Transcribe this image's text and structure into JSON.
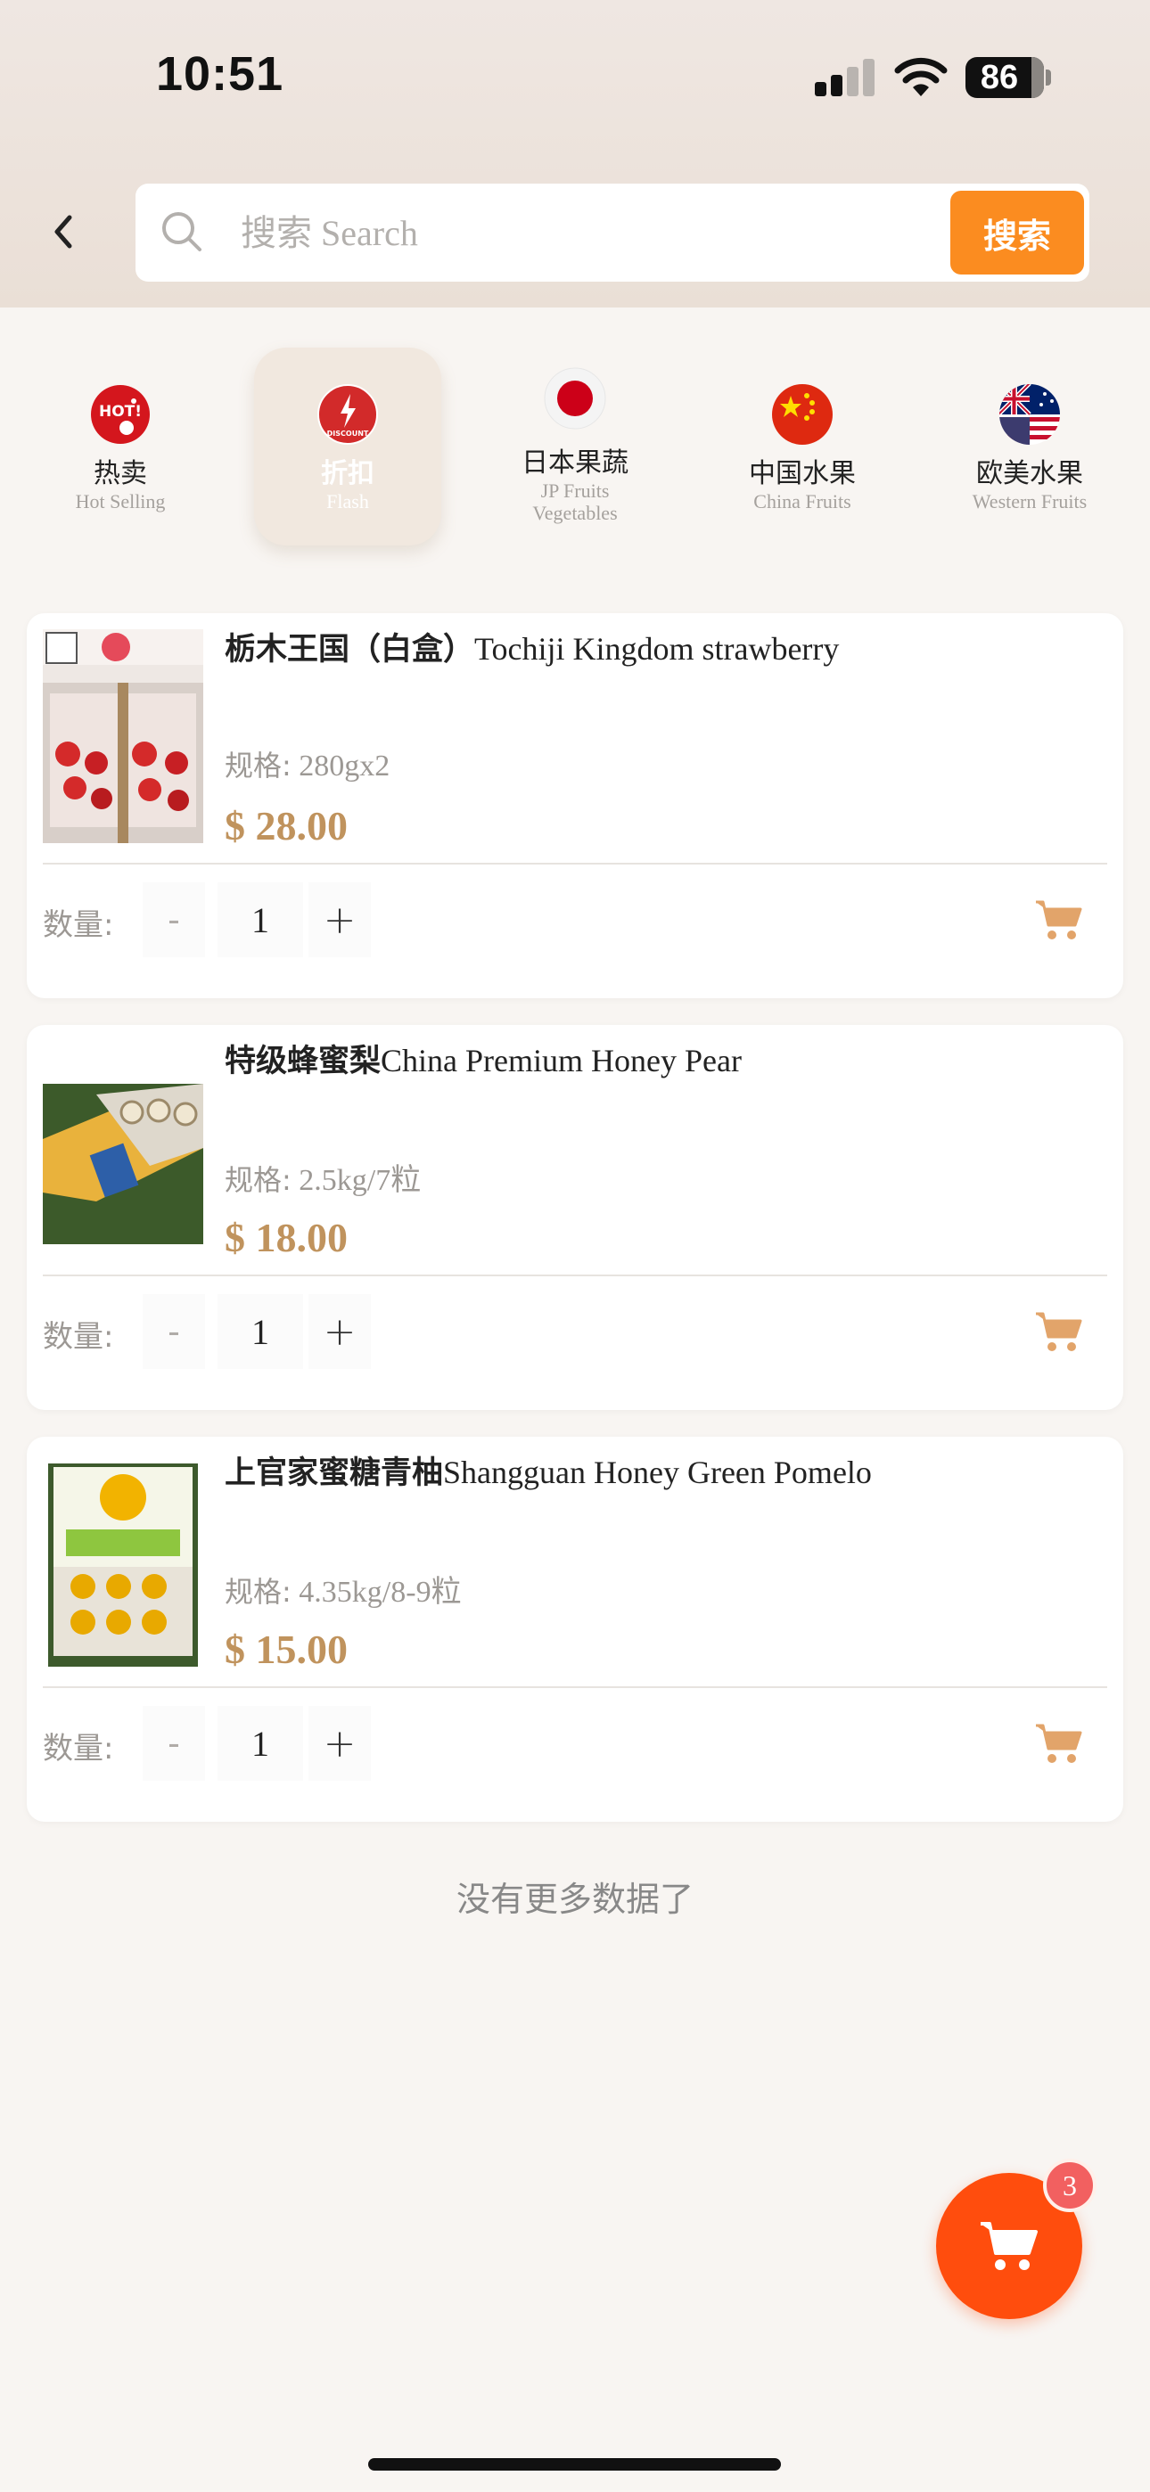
{
  "status_bar": {
    "time": "10:51",
    "battery": "86"
  },
  "search": {
    "placeholder": "搜索 Search",
    "button_label": "搜索"
  },
  "categories": [
    {
      "zh": "热卖",
      "en": "Hot Selling",
      "icon": "hot-badge-icon",
      "active": false
    },
    {
      "zh": "折扣",
      "en": "Flash",
      "icon": "discount-badge-icon",
      "active": true
    },
    {
      "zh": "日本果蔬",
      "en": "JP Fruits Vegetables",
      "icon": "japan-flag-icon",
      "active": false
    },
    {
      "zh": "中国水果",
      "en": "China Fruits",
      "icon": "china-flag-icon",
      "active": false
    },
    {
      "zh": "欧美水果",
      "en": "Western Fruits",
      "icon": "us-australia-flag-icon",
      "active": false
    }
  ],
  "spec_label": "规格:",
  "qty_label": "数量:",
  "products": [
    {
      "name_zh": "栃木王国（白盒）",
      "name_en": "Tochiji Kingdom strawberry",
      "spec": "280gx2",
      "price": "$ 28.00",
      "qty": "1"
    },
    {
      "name_zh": "特级蜂蜜梨",
      "name_en": "China Premium Honey Pear",
      "spec": "2.5kg/7粒",
      "price": "$ 18.00",
      "qty": "1"
    },
    {
      "name_zh": "上官家蜜糖青柚",
      "name_en": "Shangguan Honey Green Pomelo",
      "spec": "4.35kg/8-9粒",
      "price": "$ 15.00",
      "qty": "1"
    }
  ],
  "no_more_text": "没有更多数据了",
  "cart_count": "3",
  "colors": {
    "accent": "#fb8c20",
    "price": "#c0935d",
    "fab": "#ff4d0d"
  }
}
